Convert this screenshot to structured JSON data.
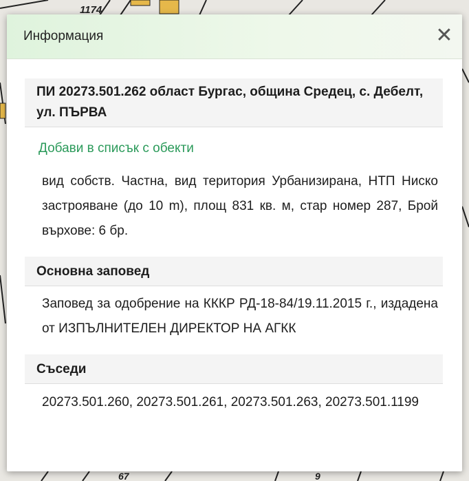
{
  "map": {
    "labels": [
      "1174",
      "67",
      "9"
    ]
  },
  "dialog": {
    "title": "Информация",
    "close_glyph": "✕",
    "parcel_heading": "ПИ 20273.501.262 област Бургас, община Средец, с. Дебелт, ул. ПЪРВА",
    "add_link": "Добави в списък с обекти",
    "description": "вид собств. Частна, вид територия Урбанизирана, НТП Ниско застрояване (до 10 m), площ 831 кв. м, стар номер 287, Брой върхове: 6 бр.",
    "order_heading": "Основна заповед",
    "order_text": "Заповед за одобрение на КККР РД-18-84/19.11.2015 г., издадена от ИЗПЪЛНИТЕЛЕН ДИРЕКТОР НА АГКК",
    "neighbors_heading": "Съседи",
    "neighbors_text": "20273.501.260, 20273.501.261, 20273.501.263, 20273.501.1199"
  }
}
